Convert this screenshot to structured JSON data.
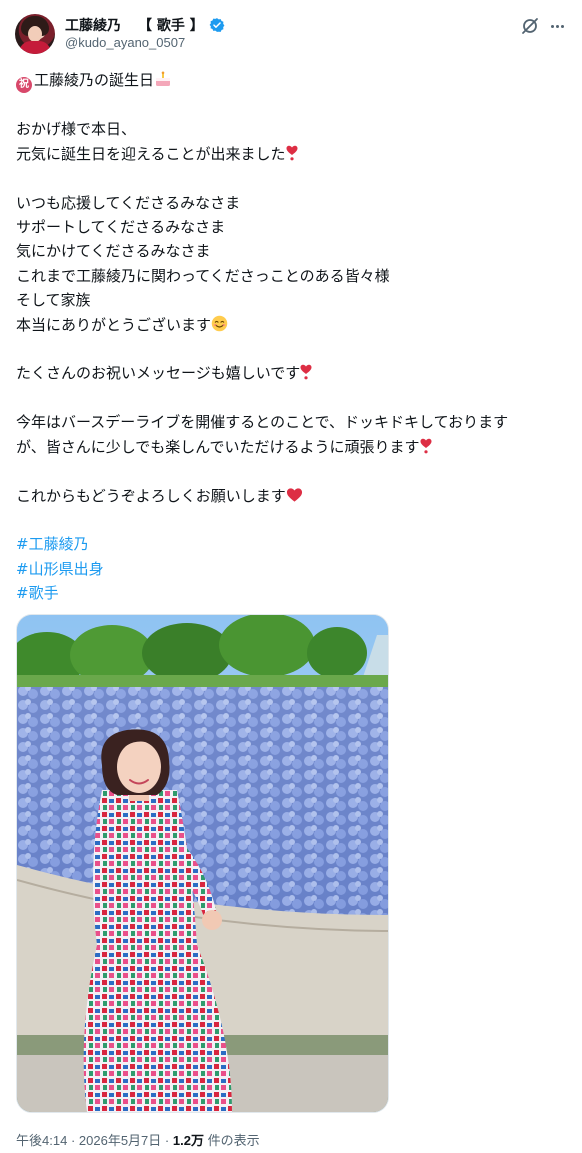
{
  "author": {
    "display_name": "工藤綾乃",
    "name_tag": "【 歌手 】",
    "handle": "@kudo_ayano_0507",
    "avatar": "avatar-photo",
    "verified_icon": "verified-badge-icon"
  },
  "actions": {
    "grok_icon": "grok-icon",
    "more_icon": "more-options-icon"
  },
  "post": {
    "line_title": "工藤綾乃の誕生日",
    "title_prefix_icon": "祝",
    "para1_line1": "おかげ様で本日、",
    "para1_line2": "元気に誕生日を迎えることが出来ました",
    "para2_line1": "いつも応援してくださるみなさま",
    "para2_line2": "サポートしてくださるみなさま",
    "para2_line3": "気にかけてくださるみなさま",
    "para2_line4": "これまで工藤綾乃に関わってくださっことのある皆々様",
    "para2_line5": "そして家族",
    "para2_line6": "本当にありがとうございます",
    "para3_line1": "たくさんのお祝いメッセージも嬉しいです",
    "para4_line1": "今年はバースデーライブを開催するとのことで、ドッキドキしております",
    "para4_line2": "が、皆さんに少しでも楽しんでいただけるように頑張ります",
    "para5_line1": "これからもどうぞよろしくお願いします",
    "hashtags": [
      "#工藤綾乃",
      "#山形県出身",
      "#歌手"
    ]
  },
  "meta": {
    "time": "午後4:14",
    "separator": "·",
    "date": "2026年5月7日",
    "views_count": "1.2万",
    "views_label": "件の表示"
  },
  "colors": {
    "link": "#1d9bf0",
    "text": "#0f1419",
    "secondary": "#536471",
    "verified": "#1d9bf0"
  }
}
